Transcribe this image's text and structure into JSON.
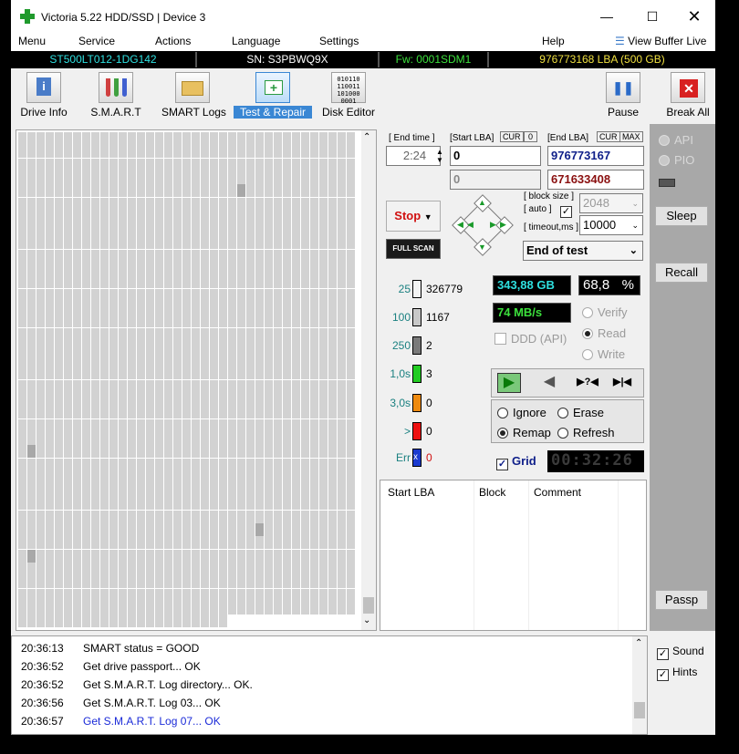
{
  "window": {
    "title": "Victoria 5.22 HDD/SSD | Device 3"
  },
  "menu": [
    "Menu",
    "Service",
    "Actions",
    "Language",
    "Settings",
    "Help"
  ],
  "view_buffer": "View Buffer Live",
  "info": {
    "model": "ST500LT012-1DG142",
    "serial": "SN: S3PBWQ9X",
    "firmware": "Fw: 0001SDM1",
    "lba": "976773168 LBA (500 GB)"
  },
  "toolbar": {
    "drive_info": "Drive Info",
    "smart": "S.M.A.R.T",
    "smart_logs": "SMART Logs",
    "test_repair": "Test & Repair",
    "disk_editor": "Disk Editor",
    "pause": "Pause",
    "break_all": "Break All"
  },
  "test": {
    "end_time_label": "[ End time ]",
    "end_time": "2:24",
    "start_lba_label": "[Start LBA]",
    "cur": "CUR",
    "zero": "0",
    "start_lba": "0",
    "start_lba2": "0",
    "end_lba_label": "[End LBA]",
    "max": "MAX",
    "end_lba": "976773167",
    "end_lba2": "671633408",
    "stop": "Stop",
    "full_scan": "FULL SCAN",
    "block_size_label": "[ block size ]",
    "auto_label": "[ auto ]",
    "block_size": "2048",
    "timeout_label": "[ timeout,ms ]",
    "timeout": "10000",
    "end_action": "End of test"
  },
  "legend": [
    {
      "label": "25",
      "count": "326779",
      "color": "#f4f4f4"
    },
    {
      "label": "100",
      "count": "1167",
      "color": "#c8c8c8"
    },
    {
      "label": "250",
      "count": "2",
      "color": "#7a7a7a"
    },
    {
      "label": "1,0s",
      "count": "3",
      "color": "#22cc22"
    },
    {
      "label": "3,0s",
      "count": "0",
      "color": "#ee8a10"
    },
    {
      "label": ">",
      "count": "0",
      "color": "#ee1010"
    },
    {
      "label": "Err",
      "count": "0",
      "color": "#1a3ad0"
    }
  ],
  "stats": {
    "gb": "343,88 GB",
    "percent": "68,8",
    "percent_sign": "%",
    "speed": "74 MB/s",
    "verify": "Verify",
    "read": "Read",
    "write": "Write",
    "ddd": "DDD (API)",
    "progress": 0.688
  },
  "actions": {
    "ignore": "Ignore",
    "erase": "Erase",
    "remap": "Remap",
    "refresh": "Refresh",
    "grid": "Grid",
    "timer": "00:32:26"
  },
  "table": {
    "columns": [
      "Start LBA",
      "Block",
      "Comment"
    ]
  },
  "right_panel": {
    "api": "API",
    "pio": "PIO",
    "sleep": "Sleep",
    "recall": "Recall",
    "passp": "Passp"
  },
  "log": [
    {
      "time": "20:36:13",
      "msg": "SMART status = GOOD",
      "color": "#000000"
    },
    {
      "time": "20:36:52",
      "msg": "Get drive passport... OK",
      "color": "#000000"
    },
    {
      "time": "20:36:52",
      "msg": "Get S.M.A.R.T. Log directory... OK.",
      "color": "#000000"
    },
    {
      "time": "20:36:56",
      "msg": "Get S.M.A.R.T. Log 03... OK",
      "color": "#000000"
    },
    {
      "time": "20:36:57",
      "msg": "Get S.M.A.R.T. Log 07...",
      "msg2": "OK",
      "color": "#1a2ad8"
    }
  ],
  "options": {
    "sound": "Sound",
    "hints": "Hints"
  },
  "grid_map": {
    "rows": 38,
    "cols": 37,
    "last_row_cols": 23,
    "dark_cells": [
      [
        4,
        24
      ],
      [
        24,
        1
      ],
      [
        30,
        26
      ],
      [
        32,
        1
      ]
    ],
    "dark_color": "#a8a8a8"
  }
}
